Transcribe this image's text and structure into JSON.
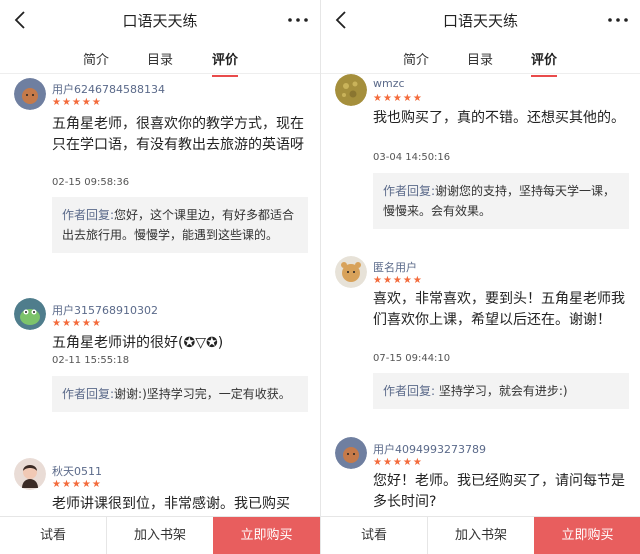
{
  "left": {
    "title": "口语天天练",
    "tabs": [
      "简介",
      "目录",
      "评价"
    ],
    "reviews": [
      {
        "user": "用户6246784588134",
        "stars": "★★★★★",
        "text": "五角星老师，很喜欢你的教学方式，现在只在学口语，有没有教出去旅游的英语呀",
        "time": "02-15 09:58:36",
        "reply_label": "作者回复:",
        "reply_text": "您好，这个课里边，有好多都适合出去旅行用。慢慢学，能遇到这些课的。"
      },
      {
        "user": "用户315768910302",
        "stars": "★★★★★",
        "text": "五角星老师讲的很好(✪▽✪)",
        "time": "02-11 15:55:18",
        "reply_label": "作者回复:",
        "reply_text": "谢谢:)坚持学习完，一定有收获。"
      },
      {
        "user": "秋天0511",
        "stars": "★★★★★",
        "text": "老师讲课很到位，非常感谢。我已购买",
        "time": "",
        "reply_label": "",
        "reply_text": ""
      }
    ],
    "bottom": {
      "trial": "试看",
      "shelf": "加入书架",
      "buy": "立即购买"
    }
  },
  "right": {
    "title": "口语天天练",
    "tabs": [
      "简介",
      "目录",
      "评价"
    ],
    "reviews": [
      {
        "user": "wmzc",
        "stars": "★★★★★",
        "text": "我也购买了，真的不错。还想买其他的。",
        "time": "03-04 14:50:16",
        "reply_label": "作者回复:",
        "reply_text": "谢谢您的支持，坚持每天学一课，慢慢来。会有效果。"
      },
      {
        "user": "匿名用户",
        "stars": "★★★★★",
        "text": "喜欢，非常喜欢，要到头！五角星老师我们喜欢你上课，希望以后还在。谢谢！",
        "time": "07-15 09:44:10",
        "reply_label": "作者回复:",
        "reply_text": "坚持学习，就会有进步:)"
      },
      {
        "user": "用户4094993273789",
        "stars": "★★★★★",
        "text": "您好！老师。我已经购买了，请问每节是多长时间?",
        "time": "",
        "reply_label": "",
        "reply_text": ""
      }
    ],
    "bottom": {
      "trial": "试看",
      "shelf": "加入书架",
      "buy": "立即购买"
    }
  },
  "colors": {
    "accent": "#e94b4b",
    "buy_button": "#e85e5e",
    "star": "#f36b3c",
    "username": "#5b6a8a",
    "reply_bg": "#f3f3f3"
  },
  "icons": {
    "back": "chevron-left-icon",
    "more": "more-dots-icon"
  }
}
